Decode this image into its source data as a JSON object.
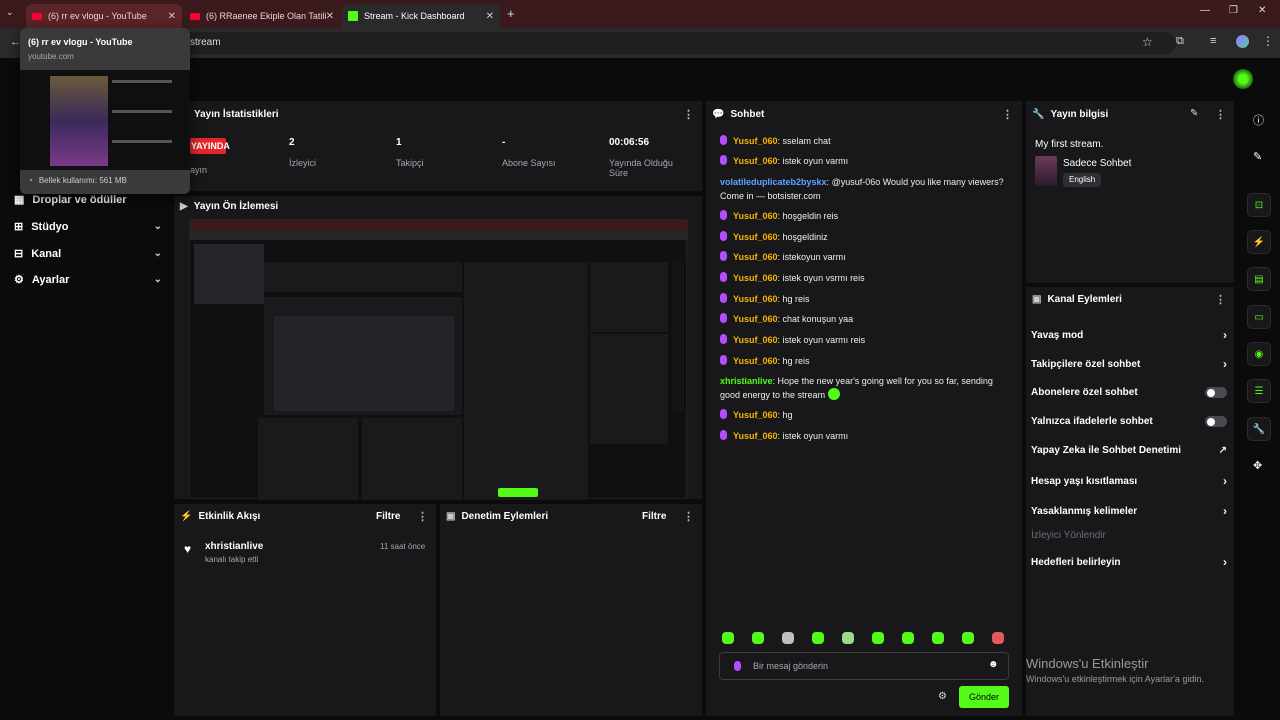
{
  "browser": {
    "tabs": [
      {
        "label": "(6) rr ev vlogu - YouTube"
      },
      {
        "label": "(6) RRaenee Ekiple Olan Tatili A"
      },
      {
        "label": "Stream - Kick Dashboard"
      }
    ],
    "url_fragment": "stream",
    "tab_preview": {
      "title": "(6) rr ev vlogu - YouTube",
      "domain": "youtube.com",
      "memory": "Bellek kullanımı: 561 MB"
    }
  },
  "sidebar": {
    "items": [
      {
        "label": "Droplar ve ödüller"
      },
      {
        "label": "Stüdyo"
      },
      {
        "label": "Kanal"
      },
      {
        "label": "Ayarlar"
      }
    ]
  },
  "stats": {
    "title": "Yayın İstatistikleri",
    "live_badge": "YAYINDA",
    "live_sub": "ayın",
    "viewers": {
      "value": "2",
      "label": "İzleyici"
    },
    "followers": {
      "value": "1",
      "label": "Takipçi"
    },
    "subs": {
      "value": "-",
      "label": "Abone Sayısı"
    },
    "duration": {
      "value": "00:06:56",
      "label": "Yayında Olduğu Süre"
    }
  },
  "preview": {
    "title": "Yayın Ön İzlemesi"
  },
  "activity": {
    "title": "Etkinlik Akışı",
    "filter": "Filtre",
    "items": [
      {
        "user": "xhristianlive",
        "action": "kanalı takip etti",
        "time": "11 saat önce"
      }
    ]
  },
  "moderation": {
    "title": "Denetim Eylemleri",
    "filter": "Filtre"
  },
  "chat": {
    "title": "Sohbet",
    "messages": [
      {
        "user": "Yusuf_060",
        "text": "sselam chat"
      },
      {
        "user": "Yusuf_060",
        "text": "istek oyun varmı"
      },
      {
        "user": "volatileduplicateb2byskx",
        "text": "@yusuf-06o Would you like many viewers? Come in — botsister.com"
      },
      {
        "user": "Yusuf_060",
        "text": "hoşgeldin reis"
      },
      {
        "user": "Yusuf_060",
        "text": "hoşgeldiniz"
      },
      {
        "user": "Yusuf_060",
        "text": "istekoyun varmı"
      },
      {
        "user": "Yusuf_060",
        "text": "istek oyun vsrmı reis"
      },
      {
        "user": "Yusuf_060",
        "text": "hg reis"
      },
      {
        "user": "Yusuf_060",
        "text": "chat konuşun yaa"
      },
      {
        "user": "Yusuf_060",
        "text": "istek oyun varmı reis"
      },
      {
        "user": "Yusuf_060",
        "text": "hg reis"
      },
      {
        "user": "xhristianlive",
        "text": "Hope the new year's going well for you so far, sending good energy to the stream"
      },
      {
        "user": "Yusuf_060",
        "text": "hg"
      },
      {
        "user": "Yusuf_060",
        "text": "istek oyun varmı"
      }
    ],
    "input_placeholder": "Bir mesaj gönderin",
    "send_label": "Gönder"
  },
  "stream_info": {
    "title": "Yayın bilgisi",
    "stream_title": "My first stream.",
    "category": "Sadece Sohbet",
    "language": "English"
  },
  "channel_actions": {
    "title": "Kanal Eylemleri",
    "items": [
      {
        "label": "Yavaş mod",
        "control": "chevron"
      },
      {
        "label": "Takipçilere özel sohbet",
        "control": "chevron"
      },
      {
        "label": "Abonelere özel sohbet",
        "control": "toggle"
      },
      {
        "label": "Yalnızca ifadelerle sohbet",
        "control": "toggle"
      },
      {
        "label": "Yapay Zeka ile Sohbet Denetimi",
        "control": "external"
      },
      {
        "label": "Hesap yaşı kısıtlaması",
        "control": "chevron"
      },
      {
        "label": "Yasaklanmış kelimeler",
        "control": "chevron"
      },
      {
        "label": "İzleyici Yönlendir",
        "control": "none"
      },
      {
        "label": "Hedefleri belirleyin",
        "control": "chevron"
      }
    ]
  },
  "watermark": {
    "title": "Windows'u Etkinleştir",
    "sub": "Windows'u etkinleştirmek için Ayarlar'a gidin."
  },
  "colors": {
    "accent": "#53fc18",
    "live": "#e3262c",
    "panel": "#18181b"
  }
}
